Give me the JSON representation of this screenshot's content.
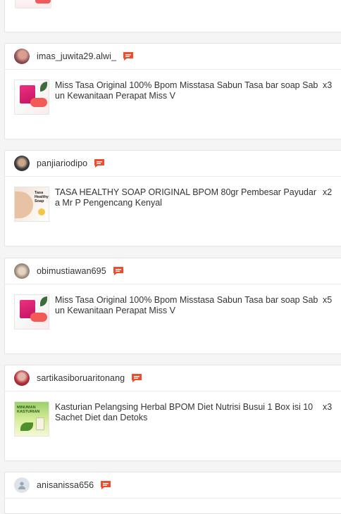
{
  "colors": {
    "accent": "#ee4d2d",
    "border": "#e4e4e4",
    "background": "#f5f5f5"
  },
  "orders": [
    {
      "username": "imas_juwita29.alwi_",
      "avatar": "user-photo",
      "product": "Miss Tasa Original 100% Bpom Misstasa Sabun Tasa bar soap Sabun Kewanitaan Perapat Miss V",
      "quantity": "x3"
    },
    {
      "username": "panjiariodipo",
      "avatar": "user-photo",
      "product": "TASA HEALTHY SOAP ORIGINAL BPOM 80gr Pembesar Payudara Mr P Pengencang Kenyal",
      "quantity": "x2"
    },
    {
      "username": "obimustiawan695",
      "avatar": "user-photo",
      "product": "Miss Tasa Original 100% Bpom Misstasa Sabun Tasa bar soap Sabun Kewanitaan Perapat Miss V",
      "quantity": "x5"
    },
    {
      "username": "sartikasiboruaritonang",
      "avatar": "user-photo",
      "product": "Kasturian Pelangsing Herbal BPOM Diet Nutrisi Busui 1 Box isi 10 Sachet Diet dan Detoks",
      "quantity": "x3"
    },
    {
      "username": "anisanissa656",
      "avatar": "default-avatar-icon"
    }
  ],
  "icons": {
    "chat": "chat-bubble-icon",
    "thumbnail_label_tasa": "Tasa Healthy Soap",
    "thumbnail_label_kasturian": "MINUMAN KASTURIAN"
  }
}
